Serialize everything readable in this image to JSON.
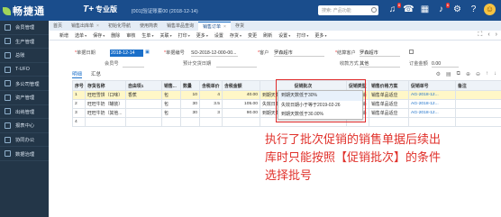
{
  "topbar": {
    "logo": "畅捷通",
    "brand": "T+",
    "edition": "专业版",
    "account": "[001]验证账套00 (2018-12-14)",
    "search_placeholder": "搜索: 产品功能",
    "notify_count": "8",
    "msg_count": "6"
  },
  "sidebar": {
    "items": [
      {
        "label": "会员管理"
      },
      {
        "label": "生产管理"
      },
      {
        "label": "总账"
      },
      {
        "label": "T-UFO"
      },
      {
        "label": "多公司管理"
      },
      {
        "label": "资产管理"
      },
      {
        "label": "出纳管理"
      },
      {
        "label": "报表中心"
      },
      {
        "label": "协同办公"
      },
      {
        "label": "数据治理"
      }
    ]
  },
  "tabs": [
    {
      "label": "首页"
    },
    {
      "label": "销售出库单"
    },
    {
      "label": "初始化导航"
    },
    {
      "label": "使用简表"
    },
    {
      "label": "销售单品查询"
    },
    {
      "label": "销售订单"
    },
    {
      "label": "存货"
    }
  ],
  "toolbar": {
    "items": [
      "新增",
      "选单",
      "保存",
      "删除",
      "审核",
      "生单",
      "关联",
      "打印",
      "更多",
      "设置",
      "存货",
      "变更",
      "刷新",
      "设置",
      "打印",
      "更多"
    ]
  },
  "form": {
    "date_label": "单据日期",
    "date_value": "2018-12-14",
    "no_label": "单据编号",
    "no_value": "SO-2018-12-000-00...",
    "customer_label": "客户",
    "customer_value": "罗森超市",
    "settle_label": "结算客户",
    "settle_value": "罗森超市",
    "member_label": "会员号",
    "delivery_label": "预计交货日期",
    "pricing_label": "收款方式",
    "pricing_value": "其他",
    "deposit_label": "订金金额",
    "deposit_value": "0.00"
  },
  "subtabs": [
    "明细",
    "汇总"
  ],
  "grid": {
    "columns": [
      "序号",
      "存货名称",
      "自由项1",
      "销售...",
      "数量",
      "含税单价",
      "含税金额",
      "促销批次",
      "促销类型",
      "销售价格方案",
      "促销单号",
      "备注"
    ],
    "rows": [
      {
        "no": "1",
        "name": "旺旺雪饼（口味）",
        "free": "香蕉",
        "unit": "包",
        "qty": "10",
        "price": "4",
        "amount": "40.00",
        "batch": "到期天数低于30%",
        "ptype": "商户促销",
        "plan": "销售单品适应",
        "pno": "AG-2018-12..."
      },
      {
        "no": "2",
        "name": "旺旺牛奶（罐装）",
        "free": "",
        "unit": "包",
        "qty": "30",
        "price": "3.5",
        "amount": "105.00",
        "batch": "失效日期小于等于2019-02-26",
        "ptype": "商户促销",
        "plan": "销售单品适应",
        "pno": "AG-2018-12..."
      },
      {
        "no": "3",
        "name": "旺旺牛奶（其他...",
        "free": "",
        "unit": "包",
        "qty": "30",
        "price": "3",
        "amount": "90.00",
        "batch": "到期天数低于30.00%",
        "ptype": "商户促销",
        "plan": "销售单品适应",
        "pno": "AG-2018-12..."
      },
      {
        "no": "4",
        "name": "",
        "free": "",
        "unit": "",
        "qty": "",
        "price": "",
        "amount": "",
        "batch": "",
        "ptype": "",
        "plan": "",
        "pno": ""
      }
    ]
  },
  "popup": {
    "options": [
      "到期天数低于30%",
      "失效日期小于等于2019-02-26",
      "到期天数低于30.00%"
    ]
  },
  "annotation": "执行了批次促销的销售单据后续出库时只能按照【促销批次】的条件选择批号"
}
